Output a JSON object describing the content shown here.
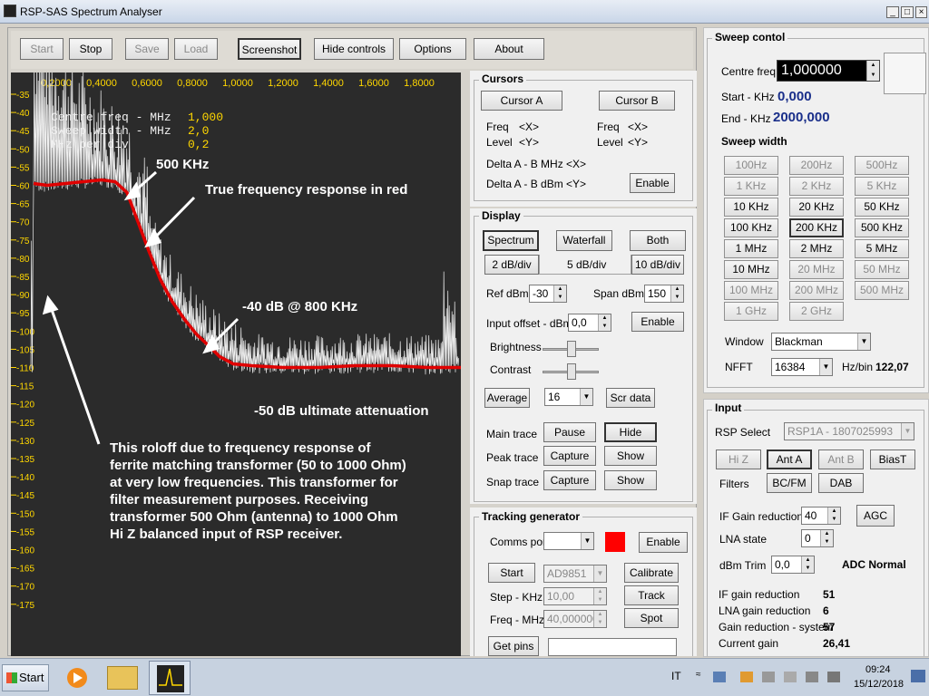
{
  "app": {
    "title": "RSP-SAS Spectrum Analyser"
  },
  "toolbar": {
    "start": "Start",
    "stop": "Stop",
    "save": "Save",
    "load": "Load",
    "screenshot": "Screenshot",
    "hide_controls": "Hide controls",
    "options": "Options",
    "about": "About"
  },
  "plot": {
    "x_ticks": [
      "0,2000",
      "0,4000",
      "0,6000",
      "0,8000",
      "1,0000",
      "1,2000",
      "1,4000",
      "1,6000",
      "1,8000"
    ],
    "y_ticks": [
      "-35",
      "-40",
      "-45",
      "-50",
      "-55",
      "-60",
      "-65",
      "-70",
      "-75",
      "-80",
      "-85",
      "-90",
      "-95",
      "-100",
      "-105",
      "-110",
      "-115",
      "-120",
      "-125",
      "-130",
      "-135",
      "-140",
      "-145",
      "-150",
      "-155",
      "-160",
      "-165",
      "-170",
      "-175"
    ],
    "info": [
      {
        "label": "Centre freq - MHz",
        "value": "1,000"
      },
      {
        "label": "Sweep width - MHz",
        "value": "2,0"
      },
      {
        "label": "MHz per div",
        "value": "0,2"
      }
    ],
    "annotations": {
      "a500": "500 KHz",
      "true_resp": "True frequency response in red",
      "a40": "-40 dB @ 800 KHz",
      "a50": "-50 dB ultimate attenuation",
      "rolloff": [
        "This roloff due to frequency response of",
        "ferrite matching transformer (50 to 1000 Ohm)",
        "at very low frequencies. This transformer for",
        "filter measurement purposes. Receiving",
        "transformer 500 Ohm (antenna) to 1000 Ohm",
        "Hi Z balanced input of RSP receiver."
      ]
    },
    "colors": {
      "background": "#2b2b2b",
      "trace": "#f0f0f0",
      "response": "#e00000",
      "tick_text": "#ffd700"
    }
  },
  "cursors": {
    "title": "Cursors",
    "cursor_a": "Cursor A",
    "cursor_b": "Cursor B",
    "freq_a": "Freq",
    "freq_a_val": "<X>",
    "level_a": "Level",
    "level_a_val": "<Y>",
    "freq_b": "Freq",
    "freq_b_val": "<X>",
    "level_b": "Level",
    "level_b_val": "<Y>",
    "delta_mhz": "Delta A - B MHz",
    "delta_mhz_val": "<X>",
    "delta_dbm": "Delta A - B dBm",
    "delta_dbm_val": "<Y>",
    "enable": "Enable"
  },
  "display": {
    "title": "Display",
    "spectrum": "Spectrum",
    "waterfall": "Waterfall",
    "both": "Both",
    "db2": "2 dB/div",
    "db5": "5 dB/div",
    "db10": "10 dB/div",
    "ref_label": "Ref dBm",
    "ref_val": "-30",
    "span_label": "Span dBm",
    "span_val": "150",
    "offset_label": "Input offset - dBm",
    "offset_val": "0,0",
    "enable": "Enable",
    "brightness": "Brightness",
    "contrast": "Contrast",
    "average": "Average",
    "average_val": "16",
    "scr_data": "Scr data",
    "main_trace": "Main trace",
    "pause": "Pause",
    "hide": "Hide",
    "peak_trace": "Peak trace",
    "capture1": "Capture",
    "show1": "Show",
    "snap_trace": "Snap trace",
    "capture2": "Capture",
    "show2": "Show"
  },
  "tracking": {
    "title": "Tracking generator",
    "comms_port": "Comms port",
    "enable": "Enable",
    "start": "Start",
    "device": "AD9851",
    "calibrate": "Calibrate",
    "step_label": "Step - KHz",
    "step_val": "10,00",
    "track": "Track",
    "freq_label": "Freq - MHz",
    "freq_val": "40,000000",
    "spot": "Spot",
    "get_pins": "Get pins"
  },
  "sweep": {
    "title": "Sweep contol",
    "centre_label": "Centre freq",
    "centre_val": "1,000000",
    "start_label": "Start - KHz",
    "start_val": "0,000",
    "end_label": "End - KHz",
    "end_val": "2000,000",
    "width_title": "Sweep width",
    "widths": [
      "100Hz",
      "200Hz",
      "500Hz",
      "1 KHz",
      "2 KHz",
      "5 KHz",
      "10 KHz",
      "20 KHz",
      "50 KHz",
      "100 KHz",
      "200 KHz",
      "500 KHz",
      "1 MHz",
      "2 MHz",
      "5 MHz",
      "10 MHz",
      "20 MHz",
      "50 MHz",
      "100 MHz",
      "200 MHz",
      "500 MHz",
      "1 GHz",
      "2 GHz"
    ],
    "window_label": "Window",
    "window_val": "Blackman",
    "nfft_label": "NFFT",
    "nfft_val": "16384",
    "hzbin_label": "Hz/bin",
    "hzbin_val": "122,07"
  },
  "input": {
    "title": "Input",
    "rsp_label": "RSP Select",
    "rsp_val": "RSP1A - 1807025993",
    "hiz": "Hi Z",
    "anta": "Ant A",
    "antb": "Ant B",
    "biast": "BiasT",
    "filters": "Filters",
    "bcfm": "BC/FM",
    "dab": "DAB",
    "if_label": "IF Gain reduction",
    "if_val": "40",
    "agc": "AGC",
    "lna_label": "LNA state",
    "lna_val": "0",
    "trim_label": "dBm Trim",
    "trim_val": "0,0",
    "adc": "ADC Normal",
    "stats": [
      {
        "label": "IF gain reduction",
        "value": "51"
      },
      {
        "label": "LNA gain reduction",
        "value": "6"
      },
      {
        "label": "Gain reduction - system",
        "value": "57"
      },
      {
        "label": "Current gain",
        "value": "26,41"
      }
    ]
  },
  "taskbar": {
    "start": "Start",
    "lang": "IT",
    "time": "09:24",
    "date": "15/12/2018"
  }
}
